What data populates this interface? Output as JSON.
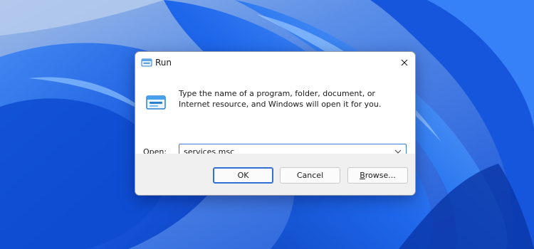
{
  "dialog": {
    "title": "Run",
    "description": "Type the name of a program, folder, document, or Internet resource, and Windows will open it for you.",
    "open_label_accel": "O",
    "open_label_rest": "pen:",
    "input_value": "services.msc"
  },
  "buttons": {
    "ok": "OK",
    "cancel": "Cancel",
    "browse_accel": "B",
    "browse_rest": "rowse..."
  },
  "icons": {
    "title": "run-icon",
    "close": "close-icon",
    "dropdown": "chevron-down-icon",
    "main": "run-icon"
  },
  "colors": {
    "accent": "#2f6fd6",
    "wallpaper": "#1f5fe0",
    "footer": "#f0f0f0"
  }
}
